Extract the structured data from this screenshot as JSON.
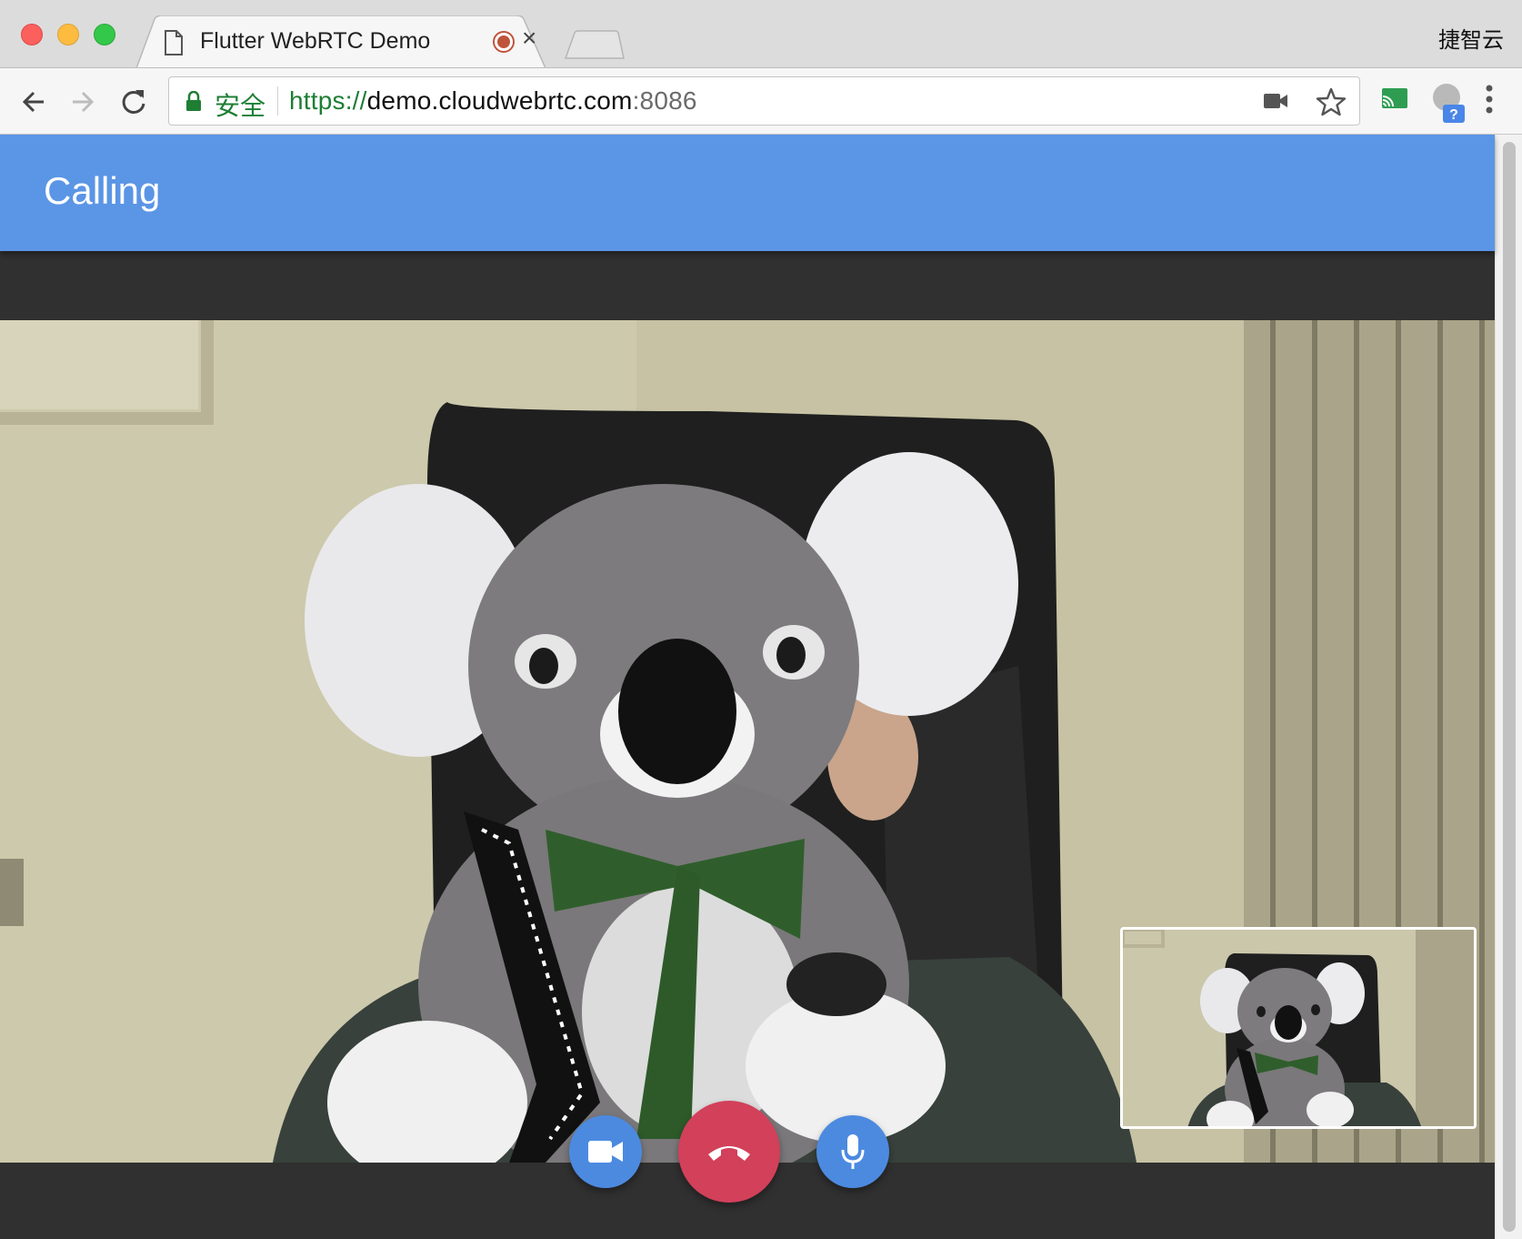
{
  "browser": {
    "tab": {
      "title": "Flutter WebRTC Demo"
    },
    "os_label": "捷智云",
    "omnibox": {
      "secure_label": "安全",
      "url_scheme": "https://",
      "url_host": "demo.cloudwebrtc.com",
      "url_port": ":8086"
    },
    "extensions": {
      "profile_badge": "?"
    }
  },
  "app": {
    "title": "Calling",
    "colors": {
      "app_bar": "#5b95e5",
      "background": "#303030",
      "control_buttons": "#4c8ae0",
      "hangup_button": "#d2405a"
    },
    "controls": [
      {
        "name": "toggle-video",
        "icon": "videocam-icon"
      },
      {
        "name": "hang-up",
        "icon": "call-end-icon"
      },
      {
        "name": "toggle-mic",
        "icon": "mic-icon"
      }
    ]
  }
}
